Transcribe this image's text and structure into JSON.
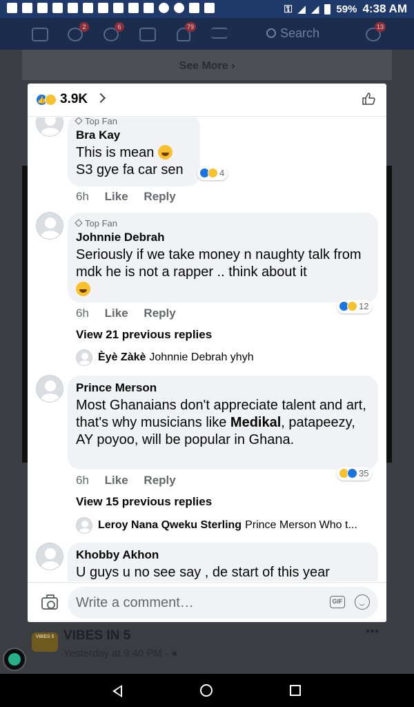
{
  "statusbar": {
    "battery": "59%",
    "time": "4:38 AM"
  },
  "nav": {
    "search_placeholder": "Search",
    "badges": [
      "2",
      "6",
      "79",
      "13"
    ]
  },
  "feed": {
    "see_more": "See More",
    "post_name": "VIBES IN 5",
    "post_time": "Yesterday at 9:40 PM",
    "avatar_text": "VIBES 5"
  },
  "modal": {
    "reaction_count": "3.9K",
    "comments": [
      {
        "badge": "Top Fan",
        "author": "Bra Kay",
        "lines": [
          "This is mean",
          "S3 gye fa car sen"
        ],
        "time": "6h",
        "like": "Like",
        "reply": "Reply",
        "reactions": "4"
      },
      {
        "badge": "Top Fan",
        "author": "Johnnie Debrah",
        "text": "Seriously if we take money n  naughty talk from mdk he is not a rapper .. think about it",
        "time": "6h",
        "like": "Like",
        "reply": "Reply",
        "reactions": "12",
        "view_previous": "View 21 previous replies",
        "reply_author": "Èyè Zàkè",
        "reply_text": "Johnnie Debrah yhyh"
      },
      {
        "author": "Prince Merson",
        "text_before": "Most Ghanaians don't appreciate talent and art, that's why musicians like ",
        "text_bold": "Medikal",
        "text_after": ", patapeezy, AY poyoo, will be popular in Ghana.",
        "time": "6h",
        "like": "Like",
        "reply": "Reply",
        "reactions": "35",
        "view_previous": "View 15 previous replies",
        "reply_author": "Leroy Nana Qweku Sterling",
        "reply_text": "Prince Merson Who t..."
      },
      {
        "author": "Khobby Akhon",
        "text": "U guys u no see say , de start of this year"
      }
    ],
    "composer_placeholder": "Write a comment…",
    "gif_label": "GIF"
  }
}
